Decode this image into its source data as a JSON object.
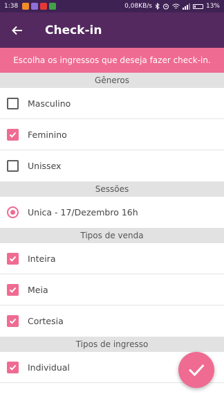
{
  "status_bar": {
    "time": "1:38",
    "network_speed": "0,08KB/s",
    "battery": "13%"
  },
  "app_bar": {
    "back_icon": "arrow-left-icon",
    "title": "Check-in"
  },
  "banner": {
    "text": "Escolha os ingressos que deseja fazer check-in."
  },
  "sections": {
    "generos": {
      "title": "Gêneros",
      "items": [
        {
          "label": "Masculino",
          "checked": false
        },
        {
          "label": "Feminino",
          "checked": true
        },
        {
          "label": "Unissex",
          "checked": false
        }
      ]
    },
    "sessoes": {
      "title": "Sessões",
      "items": [
        {
          "label": "Unica - 17/Dezembro 16h",
          "selected": true
        }
      ]
    },
    "tipos_venda": {
      "title": "Tipos de venda",
      "items": [
        {
          "label": "Inteira",
          "checked": true
        },
        {
          "label": "Meia",
          "checked": true
        },
        {
          "label": "Cortesia",
          "checked": true
        }
      ]
    },
    "tipos_ingresso": {
      "title": "Tipos de ingresso",
      "items": [
        {
          "label": "Individual",
          "checked": true
        }
      ]
    }
  },
  "fab": {
    "icon": "checkmark-icon"
  },
  "colors": {
    "primary": "#54295f",
    "status_bar": "#3f2254",
    "accent": "#ef6b92",
    "section_bg": "#e2e2e2"
  }
}
